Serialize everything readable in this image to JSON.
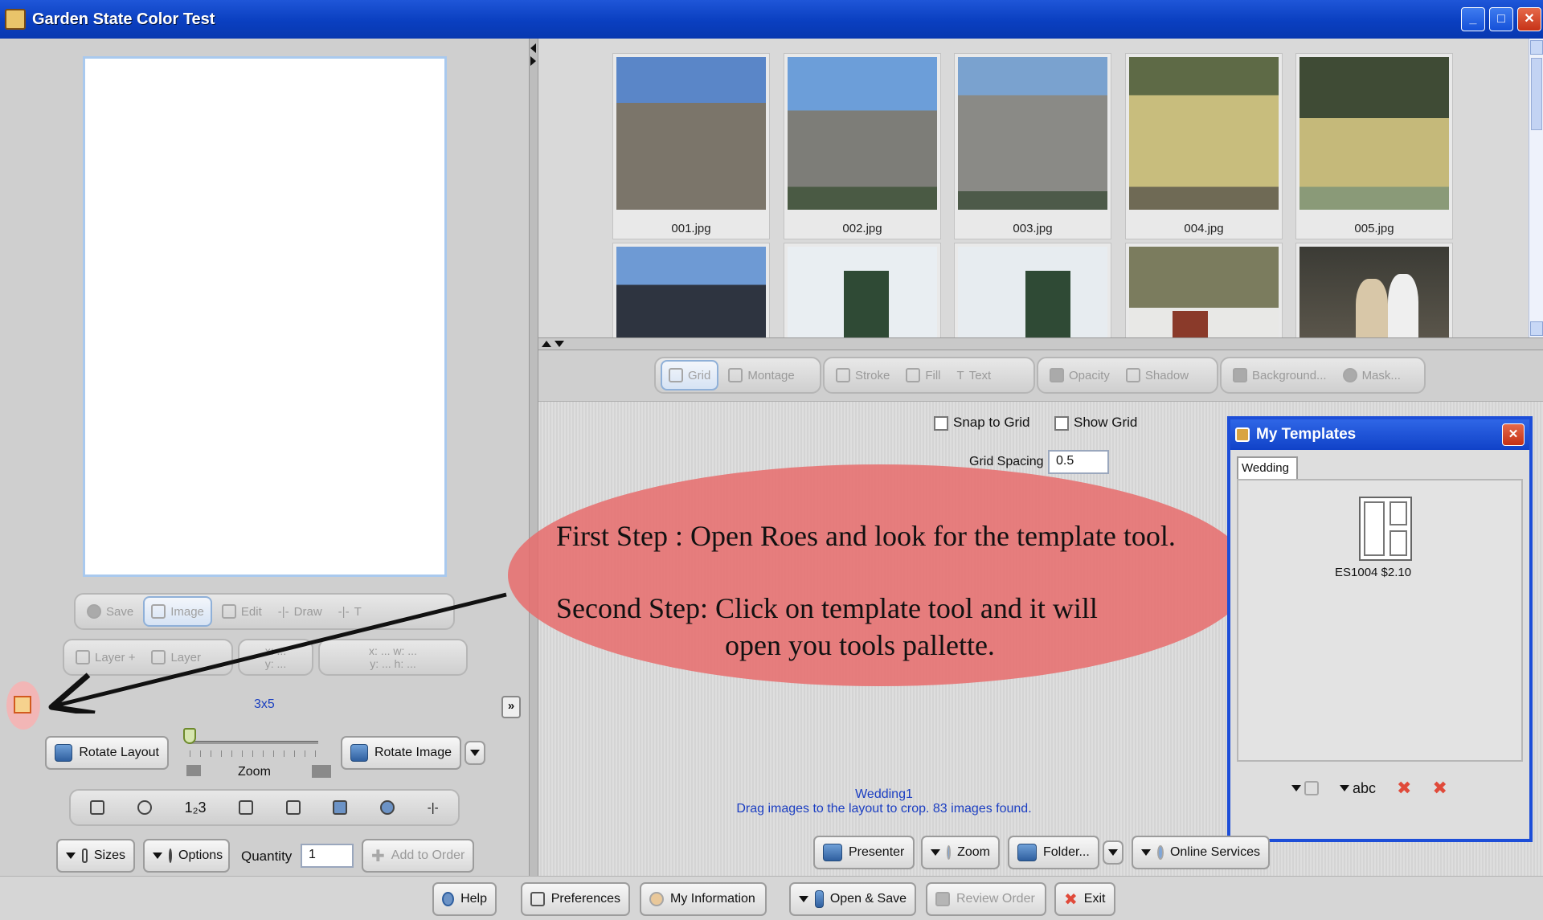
{
  "window": {
    "title": "Garden State Color Test"
  },
  "thumbnails": [
    {
      "caption": "001.jpg",
      "color": "#5b7fb4"
    },
    {
      "caption": "002.jpg",
      "color": "#6b86a6"
    },
    {
      "caption": "003.jpg",
      "color": "#7c8ea3"
    },
    {
      "caption": "004.jpg",
      "color": "#b9ad78"
    },
    {
      "caption": "005.jpg",
      "color": "#8e9a6f"
    }
  ],
  "thumbnails_row2_colors": [
    "#4e6e96",
    "#c7cfd6",
    "#c9d3d9",
    "#8a8f6b",
    "#5c5a55"
  ],
  "left_tools": {
    "row1": [
      "Save",
      "Image",
      "Edit",
      "Draw",
      "T"
    ],
    "row2": [
      "Layer +",
      "Layer",
      "x: ...",
      "y: ...",
      "x: ... w: ...",
      "y: ... h: ..."
    ],
    "size_label": "3x5",
    "rotate_layout": "Rotate Layout",
    "zoom_label": "Zoom",
    "rotate_image": "Rotate Image",
    "sizes": "Sizes",
    "options": "Options",
    "quantity_label": "Quantity",
    "quantity_value": "1",
    "add_to_order": "Add to Order"
  },
  "right_toolbar": [
    "Grid",
    "Montage",
    "Stroke",
    "Fill",
    "Text",
    "Opacity",
    "Shadow",
    "Background...",
    "Mask..."
  ],
  "grid_options": {
    "snap_to_grid": "Snap to Grid",
    "show_grid": "Show Grid",
    "grid_spacing_label": "Grid Spacing",
    "grid_spacing_value": "0.5"
  },
  "annotation": {
    "line1": "First Step : Open Roes and look for the template tool.",
    "line2": "Second Step: Click on template tool and it will",
    "line3": "open you tools pallette."
  },
  "templates_window": {
    "title": "My Templates",
    "tab": "Wedding",
    "item_label": "ES1004 $2.10",
    "tool_abc": "abc"
  },
  "status": {
    "name": "Wedding1",
    "message": "Drag images to the layout to crop. 83 images found."
  },
  "right_bottom_buttons": [
    "Presenter",
    "Zoom",
    "Folder...",
    "Online Services"
  ],
  "bottom_buttons": [
    "Help",
    "Preferences",
    "My Information",
    "Open & Save",
    "Review Order",
    "Exit"
  ]
}
